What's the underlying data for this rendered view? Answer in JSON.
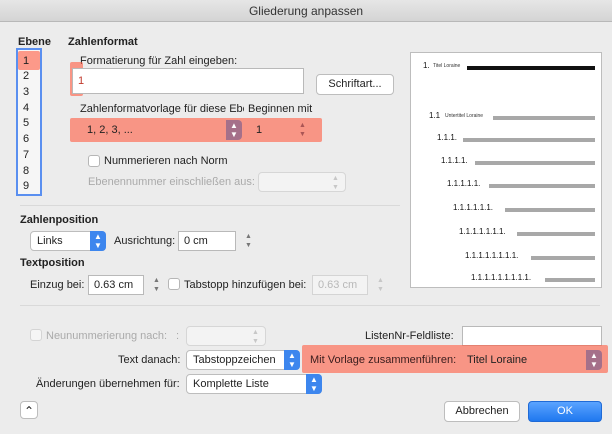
{
  "window": {
    "title": "Gliederung anpassen"
  },
  "levels": {
    "header": "Ebene",
    "items": [
      "1",
      "2",
      "3",
      "4",
      "5",
      "6",
      "7",
      "8",
      "9"
    ],
    "selected": "1"
  },
  "number_format": {
    "header": "Zahlenformat",
    "enter_label": "Formatierung für Zahl eingeben:",
    "enter_value": "1",
    "font_button": "Schriftart...",
    "style_label": "Zahlenformatvorlage für diese Ebene:",
    "style_value": "1, 2, 3, ...",
    "start_label": "Beginnen mit",
    "start_value": "1",
    "legal_label": "Nummerieren nach Norm",
    "include_label": "Ebenennummer einschließen aus:"
  },
  "number_position": {
    "header": "Zahlenposition",
    "align_value": "Links",
    "align_label": "Ausrichtung:",
    "align_at_value": "0 cm"
  },
  "text_position": {
    "header": "Textposition",
    "indent_label": "Einzug bei:",
    "indent_value": "0.63 cm",
    "tab_label": "Tabstopp hinzufügen bei:",
    "tab_value": "0.63 cm"
  },
  "preview": {
    "rows": [
      {
        "num": "1.",
        "text": "Titel Loraine"
      },
      {
        "num": "1.1",
        "text": "Untertitel Loraine"
      },
      {
        "num": "1.1.1.",
        "text": ""
      },
      {
        "num": "1.1.1.1.",
        "text": ""
      },
      {
        "num": "1.1.1.1.1.",
        "text": ""
      },
      {
        "num": "1.1.1.1.1.1.",
        "text": ""
      },
      {
        "num": "1.1.1.1.1.1.1.",
        "text": ""
      },
      {
        "num": "1.1.1.1.1.1.1.1.",
        "text": ""
      },
      {
        "num": "1.1.1.1.1.1.1.1.1.",
        "text": ""
      }
    ]
  },
  "bottom": {
    "restart_label": "Neunummerierung nach:",
    "restart_colon": ":",
    "listnum_label": "ListenNr-Feldliste:",
    "follow_label": "Text danach:",
    "follow_value": "Tabstoppzeichen",
    "link_label": "Mit Vorlage zusammenführen:",
    "link_value": "Titel Loraine",
    "apply_label": "Änderungen übernehmen für:",
    "apply_value": "Komplette Liste",
    "cancel": "Abbrechen",
    "ok": "OK",
    "collapse_glyph": "⌃"
  },
  "colors": {
    "highlight": "#ff6046",
    "level_highlight": "#5a8ff0",
    "accent": "#3d86ee"
  }
}
